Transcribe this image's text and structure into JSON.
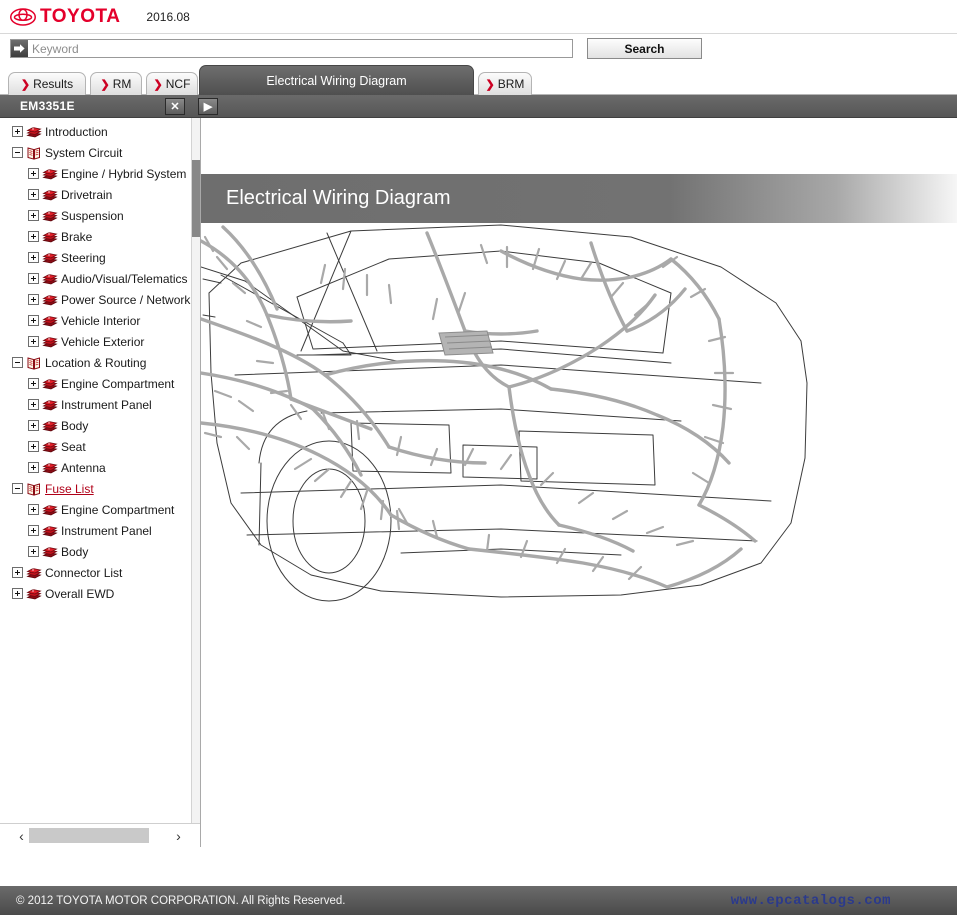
{
  "header": {
    "brand": "TOYOTA",
    "brand_color": "#e4002b",
    "version": "2016.08",
    "logo_icon": "toyota-emblem-icon"
  },
  "search": {
    "placeholder": "Keyword",
    "value": "",
    "icon": "arrow-into-box-icon",
    "button_label": "Search"
  },
  "tabs": [
    {
      "label": "Results",
      "chevron": "❯",
      "active": false
    },
    {
      "label": "RM",
      "chevron": "❯",
      "active": false
    },
    {
      "label": "NCF",
      "chevron": "❯",
      "active": false
    },
    {
      "label": "Electrical Wiring Diagram",
      "chevron": "",
      "active": true
    },
    {
      "label": "BRM",
      "chevron": "❯",
      "active": false
    }
  ],
  "docbar": {
    "doc_id": "EM3351E",
    "close_label": "✕",
    "next_label": "▶"
  },
  "tree": {
    "nodes": [
      {
        "label": "Introduction",
        "depth": 0,
        "state": "plus",
        "icon": "closed-book-icon",
        "selected": false
      },
      {
        "label": "System Circuit",
        "depth": 0,
        "state": "minus",
        "icon": "open-book-icon",
        "selected": false
      },
      {
        "label": "Engine / Hybrid System",
        "depth": 1,
        "state": "plus",
        "icon": "closed-book-icon",
        "selected": false
      },
      {
        "label": "Drivetrain",
        "depth": 1,
        "state": "plus",
        "icon": "closed-book-icon",
        "selected": false
      },
      {
        "label": "Suspension",
        "depth": 1,
        "state": "plus",
        "icon": "closed-book-icon",
        "selected": false
      },
      {
        "label": "Brake",
        "depth": 1,
        "state": "plus",
        "icon": "closed-book-icon",
        "selected": false
      },
      {
        "label": "Steering",
        "depth": 1,
        "state": "plus",
        "icon": "closed-book-icon",
        "selected": false
      },
      {
        "label": "Audio/Visual/Telematics",
        "depth": 1,
        "state": "plus",
        "icon": "closed-book-icon",
        "selected": false
      },
      {
        "label": "Power Source / Network",
        "depth": 1,
        "state": "plus",
        "icon": "closed-book-icon",
        "selected": false
      },
      {
        "label": "Vehicle Interior",
        "depth": 1,
        "state": "plus",
        "icon": "closed-book-icon",
        "selected": false
      },
      {
        "label": "Vehicle Exterior",
        "depth": 1,
        "state": "plus",
        "icon": "closed-book-icon",
        "selected": false
      },
      {
        "label": "Location & Routing",
        "depth": 0,
        "state": "minus",
        "icon": "open-book-icon",
        "selected": false
      },
      {
        "label": "Engine Compartment",
        "depth": 1,
        "state": "plus",
        "icon": "closed-book-icon",
        "selected": false
      },
      {
        "label": "Instrument Panel",
        "depth": 1,
        "state": "plus",
        "icon": "closed-book-icon",
        "selected": false
      },
      {
        "label": "Body",
        "depth": 1,
        "state": "plus",
        "icon": "closed-book-icon",
        "selected": false
      },
      {
        "label": "Seat",
        "depth": 1,
        "state": "plus",
        "icon": "closed-book-icon",
        "selected": false
      },
      {
        "label": "Antenna",
        "depth": 1,
        "state": "plus",
        "icon": "closed-book-icon",
        "selected": false
      },
      {
        "label": "Fuse List",
        "depth": 0,
        "state": "minus",
        "icon": "open-book-icon",
        "selected": true
      },
      {
        "label": "Engine Compartment",
        "depth": 1,
        "state": "plus",
        "icon": "closed-book-icon",
        "selected": false
      },
      {
        "label": "Instrument Panel",
        "depth": 1,
        "state": "plus",
        "icon": "closed-book-icon",
        "selected": false
      },
      {
        "label": "Body",
        "depth": 1,
        "state": "plus",
        "icon": "closed-book-icon",
        "selected": false
      },
      {
        "label": "Connector List",
        "depth": 0,
        "state": "plus",
        "icon": "closed-book-icon",
        "selected": false
      },
      {
        "label": "Overall EWD",
        "depth": 0,
        "state": "plus",
        "icon": "closed-book-icon",
        "selected": false
      }
    ],
    "hscroll": {
      "left_arrow": "‹",
      "right_arrow": "›"
    }
  },
  "content": {
    "title": "Electrical Wiring Diagram",
    "illustration": "vehicle-wiring-harness-line-art"
  },
  "footer": {
    "copyright": "© 2012 TOYOTA MOTOR CORPORATION. All Rights Reserved.",
    "watermark": "www.epcatalogs.com",
    "watermark_color": "#2b3a8c"
  }
}
